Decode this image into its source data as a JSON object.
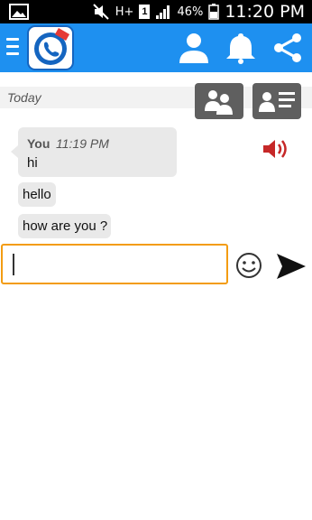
{
  "status_bar": {
    "network_label": "H+",
    "sim_slot": "1",
    "battery_percent": "46%",
    "time": "11:20 PM",
    "icons": [
      "image-icon",
      "mute-icon",
      "data-icon",
      "sim-icon",
      "signal-icon",
      "battery-icon"
    ]
  },
  "app_bar": {
    "color": "#1e90f0",
    "icons": [
      "menu-icon",
      "app-logo",
      "profile-icon",
      "notification-bell-icon",
      "share-icon"
    ]
  },
  "chat": {
    "date_label": "Today",
    "tool_buttons": [
      "group-contacts-icon",
      "contact-card-icon"
    ],
    "messages": [
      {
        "sender": "You",
        "time": "11:19 PM",
        "text": "hi"
      },
      {
        "text": "hello"
      },
      {
        "text": "how are you ?"
      }
    ],
    "speaker_icon": "speaker-icon"
  },
  "composer": {
    "value": "",
    "placeholder": "",
    "accent_color": "#f39c12",
    "emoji_icon": "smiley-icon",
    "send_icon": "send-icon"
  }
}
